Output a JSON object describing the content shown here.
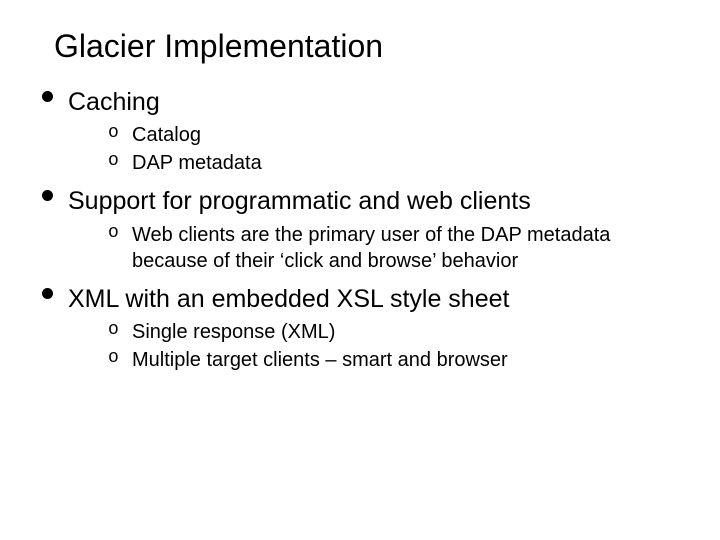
{
  "title": "Glacier Implementation",
  "bullets": [
    {
      "text": "Caching",
      "sub": [
        "Catalog",
        "DAP metadata"
      ]
    },
    {
      "text": "Support for programmatic and web clients",
      "sub": [
        "Web clients are the primary user of the DAP metadata because of their ‘click and browse’ behavior"
      ]
    },
    {
      "text": "XML with an embedded XSL style sheet",
      "sub": [
        "Single response (XML)",
        "Multiple target clients – smart and browser"
      ]
    }
  ]
}
